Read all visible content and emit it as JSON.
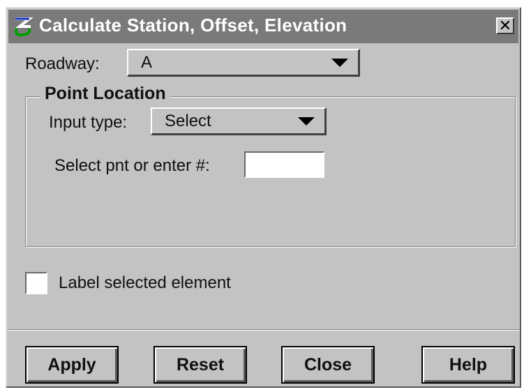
{
  "window": {
    "title": "Calculate Station, Offset, Elevation",
    "title_icon": "geopak-logo-icon",
    "close_glyph": "✕"
  },
  "roadway": {
    "label": "Roadway:",
    "value": "A"
  },
  "point_location": {
    "group_title": "Point Location",
    "input_type_label": "Input type:",
    "input_type_value": "Select",
    "select_point_label": "Select pnt or enter #:",
    "select_point_value": ""
  },
  "label_selected_element": {
    "label": "Label selected element",
    "checked": false
  },
  "buttons": {
    "apply": "Apply",
    "reset": "Reset",
    "close": "Close",
    "help": "Help"
  },
  "colors": {
    "window_bg": "#c3c3c3",
    "titlebar_bg": "#7a7a7a",
    "title_text": "#ffffff"
  }
}
